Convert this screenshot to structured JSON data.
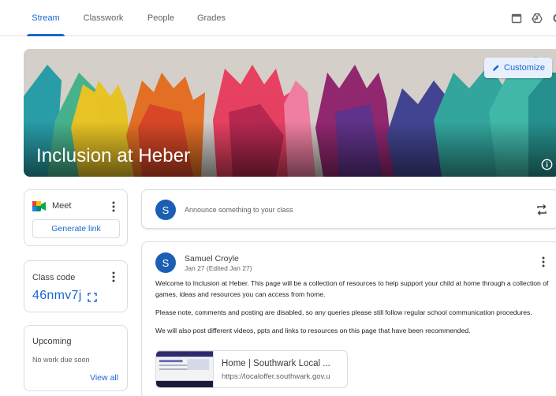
{
  "nav": {
    "tabs": [
      {
        "label": "Stream",
        "active": true
      },
      {
        "label": "Classwork",
        "active": false
      },
      {
        "label": "People",
        "active": false
      },
      {
        "label": "Grades",
        "active": false
      }
    ],
    "icons": [
      "calendar-icon",
      "drive-icon",
      "settings-icon"
    ]
  },
  "banner": {
    "title": "Inclusion at Heber",
    "customize_label": "Customize",
    "info_icon": "info-icon"
  },
  "meet": {
    "label": "Meet",
    "generate_link_label": "Generate link"
  },
  "class_code": {
    "label": "Class code",
    "value": "46nmv7j"
  },
  "upcoming": {
    "label": "Upcoming",
    "empty_text": "No work due soon",
    "view_all_label": "View all"
  },
  "announce": {
    "avatar_initial": "S",
    "placeholder": "Announce something to your class"
  },
  "post": {
    "avatar_initial": "S",
    "author": "Samuel Croyle",
    "date": "Jan 27 (Edited Jan 27)",
    "paragraph_1": "Welcome to Inclusion at Heber.  This page will be a collection of resources to help support your child at home through a collection of games, ideas and resources you can access from home.",
    "paragraph_2": "Please note, comments and posting are disabled, so any queries please still follow regular school communication procedures.",
    "paragraph_3": "We will also post different videos, ppts and links to resources on this page that have been recommended.",
    "attachment": {
      "title": "Home | Southwark Local ...",
      "url": "https://localoffer.southwark.gov.u"
    }
  },
  "colors": {
    "accent": "#1967d2",
    "avatar": "#1a5fb4",
    "border": "#dadce0"
  }
}
